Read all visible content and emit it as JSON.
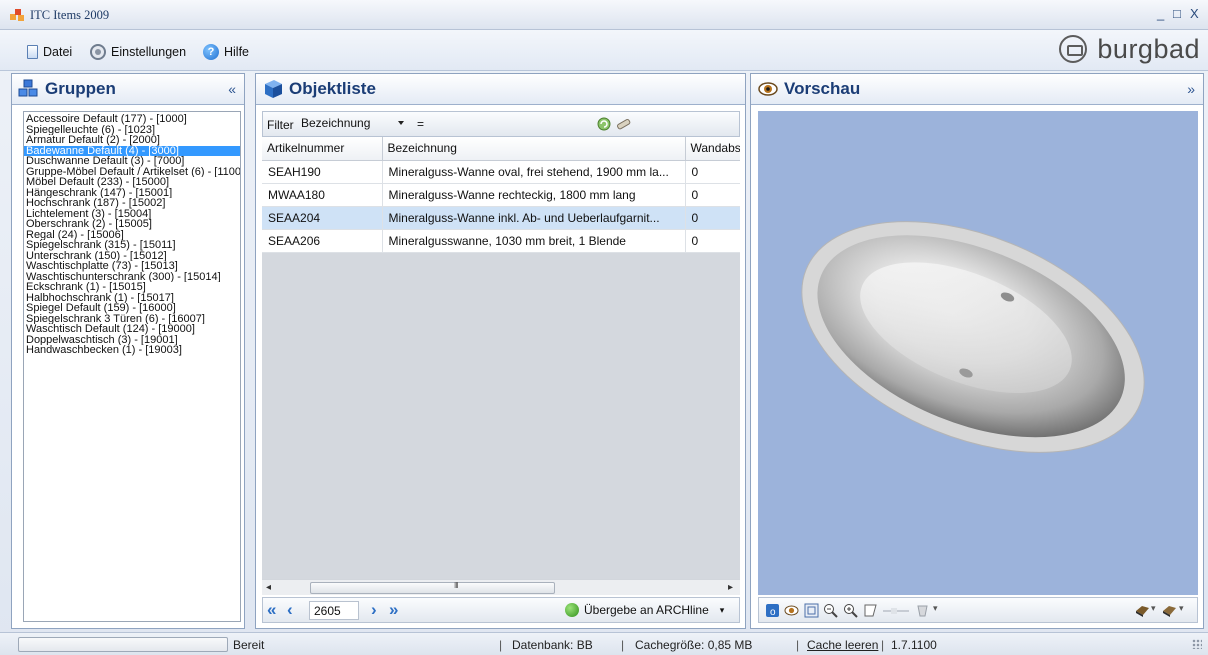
{
  "window": {
    "title": "ITC Items 2009",
    "controls": [
      "_",
      "□",
      "X"
    ]
  },
  "menu": {
    "items": [
      {
        "label": "Datei",
        "icon": "document-icon"
      },
      {
        "label": "Einstellungen",
        "icon": "settings-icon"
      },
      {
        "label": "Hilfe",
        "icon": "help-icon"
      }
    ],
    "brand": "burgbad"
  },
  "panels": {
    "gruppen": {
      "title": "Gruppen",
      "collapse": "«",
      "items": [
        "Accessoire Default (177) - [1000]",
        "Spiegelleuchte (6) - [1023]",
        "Armatur Default (2) - [2000]",
        "Badewanne Default (4) - [3000]",
        "Duschwanne Default (3) - [7000]",
        "Gruppe-Möbel Default / Artikelset (6) - [1100",
        "Möbel Default (233) - [15000]",
        "Hängeschrank (147) - [15001]",
        "Hochschrank (187) - [15002]",
        "Lichtelement (3) - [15004]",
        "Oberschrank (2) - [15005]",
        "Regal (24) - [15006]",
        "Spiegelschrank (315) - [15011]",
        "Unterschrank (150) - [15012]",
        "Waschtischplatte (73) - [15013]",
        "Waschtischunterschrank (300) - [15014]",
        "Eckschrank (1) - [15015]",
        "Halbhochschrank (1) - [15017]",
        "Spiegel Default (159) - [16000]",
        "Spiegelschrank 3 Türen (6) - [16007]",
        "Waschtisch Default (124) - [19000]",
        "Doppelwaschtisch (3) - [19001]",
        "Handwaschbecken (1) - [19003]"
      ],
      "selected_index": 3
    },
    "objektliste": {
      "title": "Objektliste",
      "filter_label": "Filter",
      "filter_value": "Bezeichnung",
      "filter_op": "=",
      "columns": [
        "Artikelnummer",
        "Bezeichnung",
        "Wandabs"
      ],
      "rows": [
        [
          "SEAH190",
          "Mineralguss-Wanne oval, frei stehend, 1900 mm la...",
          "0"
        ],
        [
          "MWAA180",
          "Mineralguss-Wanne rechteckig, 1800 mm lang",
          "0"
        ],
        [
          "SEAA204",
          "Mineralguss-Wanne inkl. Ab- und Ueberlaufgarnit...",
          "0"
        ],
        [
          "SEAA206",
          "Mineralgusswanne, 1030 mm breit, 1 Blende",
          "0"
        ]
      ],
      "selected_row": 2,
      "nav_count": "2605",
      "transfer_label": "Übergebe an  ARCHline",
      "scroll_grip": "III"
    },
    "vorschau": {
      "title": "Vorschau",
      "collapse": "»"
    }
  },
  "status": {
    "state": "Bereit",
    "db": "Datenbank: BB",
    "cache": "Cachegröße:  0,85 MB",
    "cache_clear": "Cache leeren",
    "version": "1.7.1100"
  },
  "colors": {
    "accent": "#1b3d76",
    "selection": "#3399ff",
    "row_selection": "#cfe2f6",
    "preview_bg": "#9cb3db"
  }
}
